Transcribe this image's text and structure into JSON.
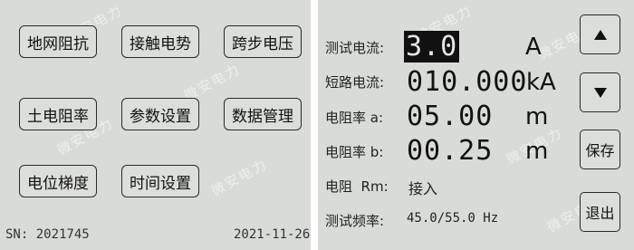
{
  "left_panel": {
    "menu": [
      {
        "label": "地网阻抗"
      },
      {
        "label": "接触电势"
      },
      {
        "label": "跨步电压"
      },
      {
        "label": "土电阻率"
      },
      {
        "label": "参数设置"
      },
      {
        "label": "数据管理"
      },
      {
        "label": "电位梯度"
      },
      {
        "label": "时间设置"
      }
    ],
    "serial": "SN: 2021745",
    "date": "2021-11-26"
  },
  "right_panel": {
    "test_current": {
      "label": "测试电流:",
      "value": "3.0",
      "unit": "A"
    },
    "short_current": {
      "label": "短路电流:",
      "value": "010.000",
      "unit": "kA"
    },
    "resistivity_a": {
      "label": "电阻率 a:",
      "value": "05.00",
      "unit": "m"
    },
    "resistivity_b": {
      "label": "电阻率 b:",
      "value": "00.25",
      "unit": "m"
    },
    "resistance_rm": {
      "label": "电阻  Rm:",
      "value": "接入"
    },
    "test_freq": {
      "label": "测试频率:",
      "value": "45.0/55.0 Hz"
    },
    "buttons": {
      "up": "▲",
      "down": "▼",
      "save": "保存",
      "exit": "退出"
    }
  },
  "watermark": {
    "text": "微安电力"
  }
}
